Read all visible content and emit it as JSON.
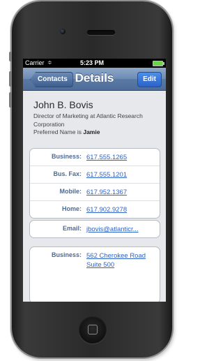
{
  "status_bar": {
    "carrier": "Carrier",
    "time": "5:23 PM"
  },
  "nav": {
    "back_label": "Contacts",
    "title": "Details",
    "edit_label": "Edit"
  },
  "contact": {
    "name": "John B. Bovis",
    "title": "Director of Marketing at Atlantic Research Corporation",
    "preferred_prefix": "Preferred Name is ",
    "preferred_name": "Jamie"
  },
  "phones": [
    {
      "label": "Business:",
      "value": "617.555.1265"
    },
    {
      "label": "Bus. Fax:",
      "value": "617.555.1201"
    },
    {
      "label": "Mobile:",
      "value": "617.952.1367"
    },
    {
      "label": "Home:",
      "value": "617.902.9278"
    }
  ],
  "email": {
    "label": "Email:",
    "value": "jbovis@atlanticr..."
  },
  "address": {
    "label": "Business:",
    "line1": "562 Cherokee Road",
    "line2": "Suite 500"
  }
}
